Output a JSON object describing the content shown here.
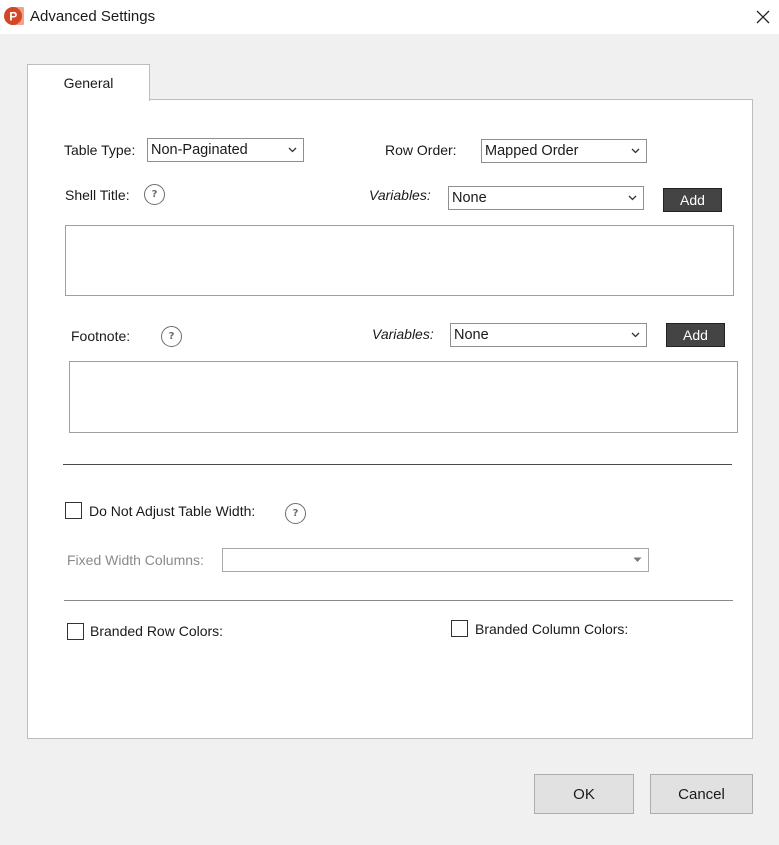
{
  "window": {
    "title": "Advanced Settings"
  },
  "tabs": [
    {
      "label": "General"
    }
  ],
  "general": {
    "table_type": {
      "label": "Table Type:",
      "value": "Non-Paginated"
    },
    "row_order": {
      "label": "Row Order:",
      "value": "Mapped Order"
    },
    "shell_title": {
      "label": "Shell Title:",
      "variables_label": "Variables:",
      "variables_value": "None",
      "add_label": "Add"
    },
    "footnote": {
      "label": "Footnote:",
      "variables_label": "Variables:",
      "variables_value": "None",
      "add_label": "Add"
    },
    "do_not_adjust_width": {
      "label": "Do Not Adjust Table Width:"
    },
    "fixed_width_columns": {
      "label": "Fixed Width Columns:",
      "value": ""
    },
    "branded_row_colors": {
      "label": "Branded Row Colors:"
    },
    "branded_column_colors": {
      "label": "Branded Column Colors:"
    }
  },
  "footer": {
    "ok_label": "OK",
    "cancel_label": "Cancel"
  },
  "icons": {
    "app": "powerpoint-app-icon",
    "close": "close-icon",
    "help": "help-icon",
    "dropdown": "chevron-down-icon"
  },
  "colors": {
    "app_icon": "#d24726",
    "button_dark": "#444444"
  }
}
